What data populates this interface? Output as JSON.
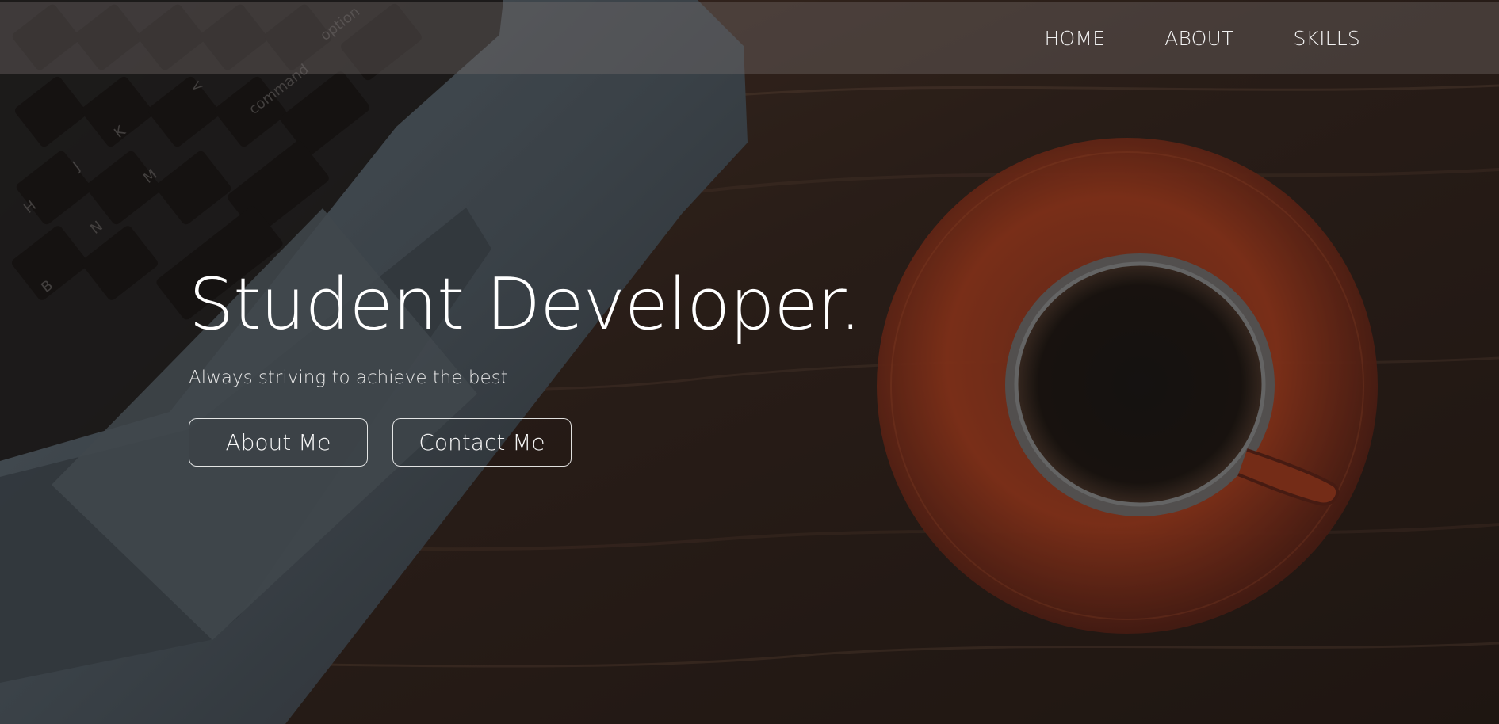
{
  "nav": {
    "items": [
      {
        "label": "HOME"
      },
      {
        "label": "ABOUT"
      },
      {
        "label": "SKILLS"
      }
    ]
  },
  "hero": {
    "title": "Student Developer.",
    "subtitle": "Always striving to achieve the best",
    "buttons": [
      {
        "label": "About Me"
      },
      {
        "label": "Contact Me"
      }
    ]
  },
  "icons": {
    "background": "desk-laptop-coffee-image"
  },
  "colors": {
    "overlay": "#3b2d24",
    "text": "#ffffff",
    "button_border": "#e8e8e8",
    "saucer": "#c3451f"
  }
}
